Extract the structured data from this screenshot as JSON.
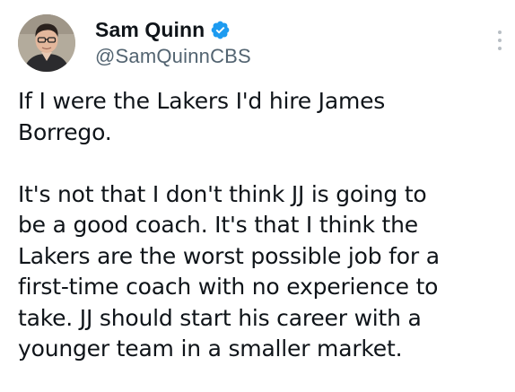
{
  "author": {
    "display_name": "Sam Quinn",
    "handle": "@SamQuinnCBS",
    "verified": true,
    "avatar_icon": "profile-photo",
    "verified_icon": "verified-check-icon"
  },
  "colors": {
    "text": "#0f1419",
    "secondary_text": "#536471",
    "verified_blue": "#1d9bf0",
    "background": "#ffffff"
  },
  "menu": {
    "icon": "more-vertical-icon"
  },
  "tweet": {
    "paragraph_1": [
      "If I were the Lakers I'd hire James",
      "Borrego."
    ],
    "paragraph_2": [
      "It's not that I don't think JJ is going to",
      "be a good coach. It's that I think the",
      "Lakers are the worst possible job for a",
      "first-time coach with no experience to",
      "take. JJ should start his career with a",
      "younger team in a smaller market."
    ]
  }
}
